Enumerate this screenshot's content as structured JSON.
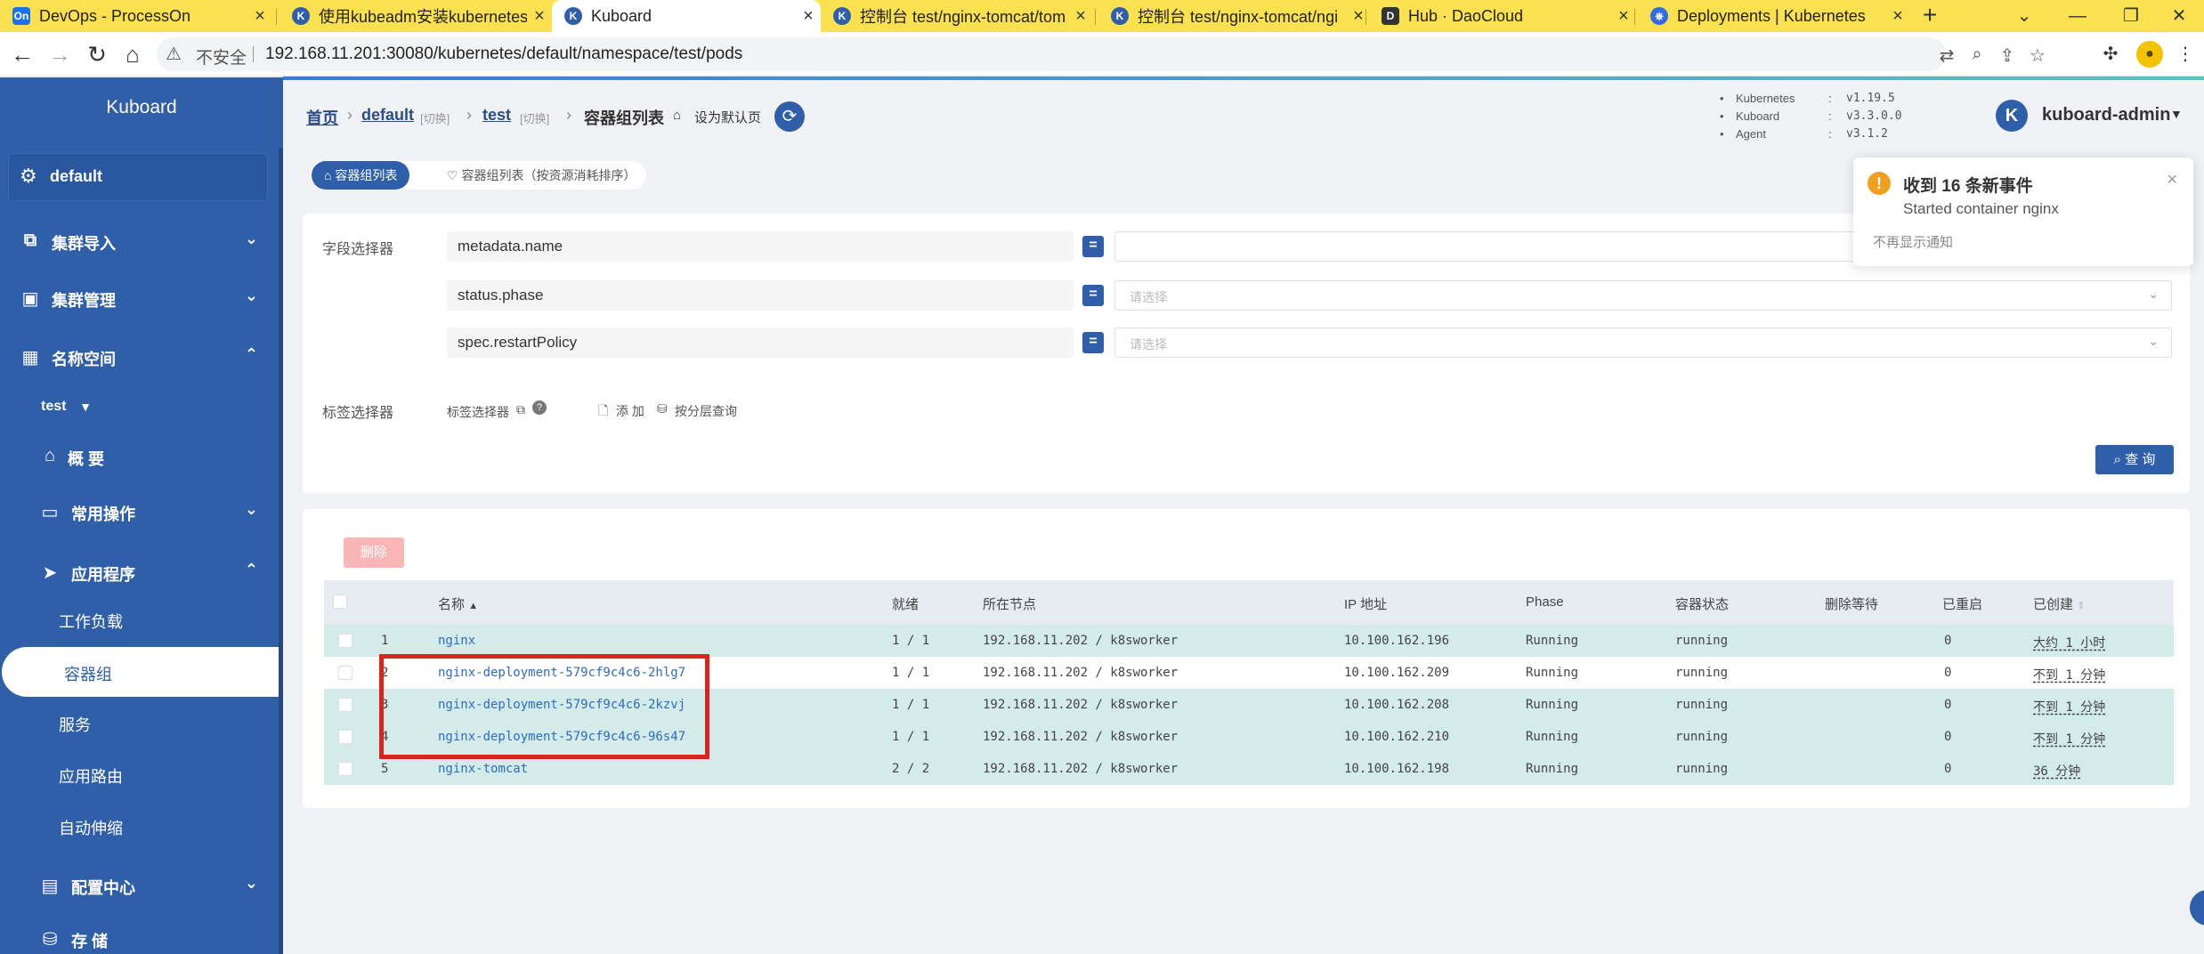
{
  "browser": {
    "tabs": [
      {
        "title": "DevOps - ProcessOn",
        "favicon": "On",
        "color": "#1a73e8"
      },
      {
        "title": "使用kubeadm安装kubernetes",
        "favicon": "K",
        "color": "#2f5fa8"
      },
      {
        "title": "Kuboard",
        "favicon": "K",
        "color": "#2f5fa8"
      },
      {
        "title": "控制台 test/nginx-tomcat/tom",
        "favicon": "K",
        "color": "#2f5fa8"
      },
      {
        "title": "控制台 test/nginx-tomcat/ngi",
        "favicon": "K",
        "color": "#2f5fa8"
      },
      {
        "title": "Hub · DaoCloud",
        "favicon": "D",
        "color": "#333333"
      },
      {
        "title": "Deployments | Kubernetes",
        "favicon": "⎈",
        "color": "#326ce5"
      }
    ],
    "insecure_label": "不安全",
    "url": "192.168.11.201:30080/kubernetes/default/namespace/test/pods"
  },
  "sidebar": {
    "brand": "Kuboard",
    "namespace_current": "default",
    "items": [
      {
        "label": "集群导入"
      },
      {
        "label": "集群管理"
      },
      {
        "label": "名称空间"
      }
    ],
    "namespace_selector": "test",
    "overview": "概 要",
    "common_ops": "常用操作",
    "apps": "应用程序",
    "sub_items": [
      "工作负载",
      "容器组",
      "服务",
      "应用路由",
      "自动伸缩"
    ],
    "config_center": "配置中心",
    "storage": "存 储"
  },
  "header": {
    "breadcrumb": {
      "home": "首页",
      "cluster": "default",
      "cluster_tag": "[切换]",
      "namespace": "test",
      "namespace_tag": "[切换]",
      "page": "容器组列表",
      "set_default": "设为默认页"
    },
    "versions": [
      {
        "name": "Kubernetes",
        "value": "v1.19.5"
      },
      {
        "name": "Kuboard",
        "value": "v3.3.0.0"
      },
      {
        "name": "Agent",
        "value": "v3.1.2"
      }
    ],
    "user": {
      "initial": "K",
      "name": "kuboard-admin"
    }
  },
  "subtabs": {
    "active": "容器组列表",
    "inactive": "容器组列表（按资源消耗排序）"
  },
  "filters": {
    "field_selector_label": "字段选择器",
    "fields": [
      {
        "key": "metadata.name",
        "op": "=",
        "value": "",
        "placeholder": ""
      },
      {
        "key": "status.phase",
        "op": "=",
        "value": "",
        "placeholder": "请选择"
      },
      {
        "key": "spec.restartPolicy",
        "op": "=",
        "value": "",
        "placeholder": "请选择"
      }
    ],
    "label_selector_label": "标签选择器",
    "label_selector_link": "标签选择器",
    "add": "添 加",
    "by_layer": "按分层查询",
    "query_button": "查 询"
  },
  "toast": {
    "title": "收到 16 条新事件",
    "message": "Started container nginx",
    "dismiss": "不再显示通知"
  },
  "table": {
    "delete_button": "删除",
    "columns": [
      "名称",
      "就绪",
      "所在节点",
      "IP 地址",
      "Phase",
      "容器状态",
      "删除等待",
      "已重启",
      "已创建"
    ],
    "rows": [
      {
        "no": "1",
        "name": "nginx",
        "ready": "1 / 1",
        "node": "192.168.11.202 / k8sworker",
        "ip": "10.100.162.196",
        "phase": "Running",
        "state": "running",
        "restarts": "0",
        "created": "大约 1 小时"
      },
      {
        "no": "2",
        "name": "nginx-deployment-579cf9c4c6-2hlg7",
        "ready": "1 / 1",
        "node": "192.168.11.202 / k8sworker",
        "ip": "10.100.162.209",
        "phase": "Running",
        "state": "running",
        "restarts": "0",
        "created": "不到 1 分钟"
      },
      {
        "no": "3",
        "name": "nginx-deployment-579cf9c4c6-2kzvj",
        "ready": "1 / 1",
        "node": "192.168.11.202 / k8sworker",
        "ip": "10.100.162.208",
        "phase": "Running",
        "state": "running",
        "restarts": "0",
        "created": "不到 1 分钟"
      },
      {
        "no": "4",
        "name": "nginx-deployment-579cf9c4c6-96s47",
        "ready": "1 / 1",
        "node": "192.168.11.202 / k8sworker",
        "ip": "10.100.162.210",
        "phase": "Running",
        "state": "running",
        "restarts": "0",
        "created": "不到 1 分钟"
      },
      {
        "no": "5",
        "name": "nginx-tomcat",
        "ready": "2 / 2",
        "node": "192.168.11.202 / k8sworker",
        "ip": "10.100.162.198",
        "phase": "Running",
        "state": "running",
        "restarts": "0",
        "created": "36 分钟"
      }
    ]
  },
  "colors": {
    "primary": "#2f5fa8",
    "row_highlight": "#d3ecea",
    "annotation_box": "#d9261c",
    "tabbar": "#fbe14f"
  }
}
